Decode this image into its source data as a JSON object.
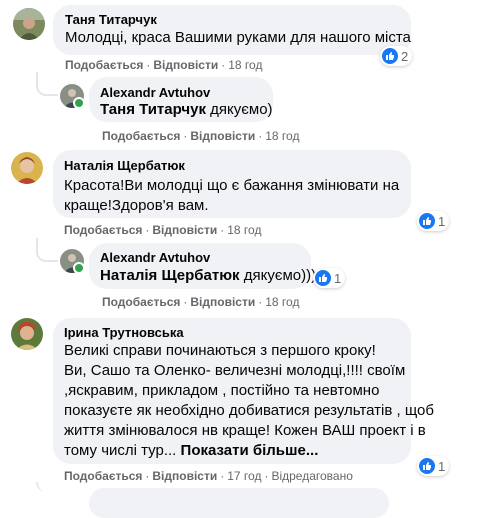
{
  "actions": {
    "like": "Подобається",
    "reply": "Відповісти",
    "edited": "Відредаговано"
  },
  "icons": {
    "like": "like-icon",
    "more": "more-icon"
  },
  "colors": {
    "like_blue": "#1877f2",
    "bubble": "#f0f2f5",
    "meta": "#65676b",
    "online": "#31a24c"
  },
  "comments": [
    {
      "author": "Таня Титарчук",
      "text": "Молодці, краса Вашими руками для нашого міста",
      "time": "18 год",
      "reactions": "2",
      "reply": {
        "author": "Alexandr Avtuhov",
        "mention": "Таня Титарчук",
        "text": " дякуємо)",
        "time": "18 год"
      }
    },
    {
      "author": "Наталія Щербатюк",
      "lines": [
        "Красота!Ви молодці що є бажання змінювати на",
        "краще!Здоров'я вам."
      ],
      "time": "18 год",
      "reactions": "1",
      "reply": {
        "author": "Alexandr Avtuhov",
        "mention": "Наталія Щербатюк",
        "text": " дякуємо)))",
        "time": "18 год",
        "reactions": "1"
      }
    },
    {
      "author": "Ірина Трутновська",
      "lines": [
        "Великі справи починаються з першого кроку!",
        "Ви, Сашо та Оленко- величезні молодці,!!!! своїм",
        ",яскравим, прикладом , постійно та невтомно",
        "показуєте як необхідно добиватися результатів , щоб",
        "життя змінювалося нв краще! Кожен ВАШ проект і в"
      ],
      "last_line": "тому числі тур...",
      "see_more": "Показати більше...",
      "time": "17 год",
      "reactions": "1"
    }
  ]
}
